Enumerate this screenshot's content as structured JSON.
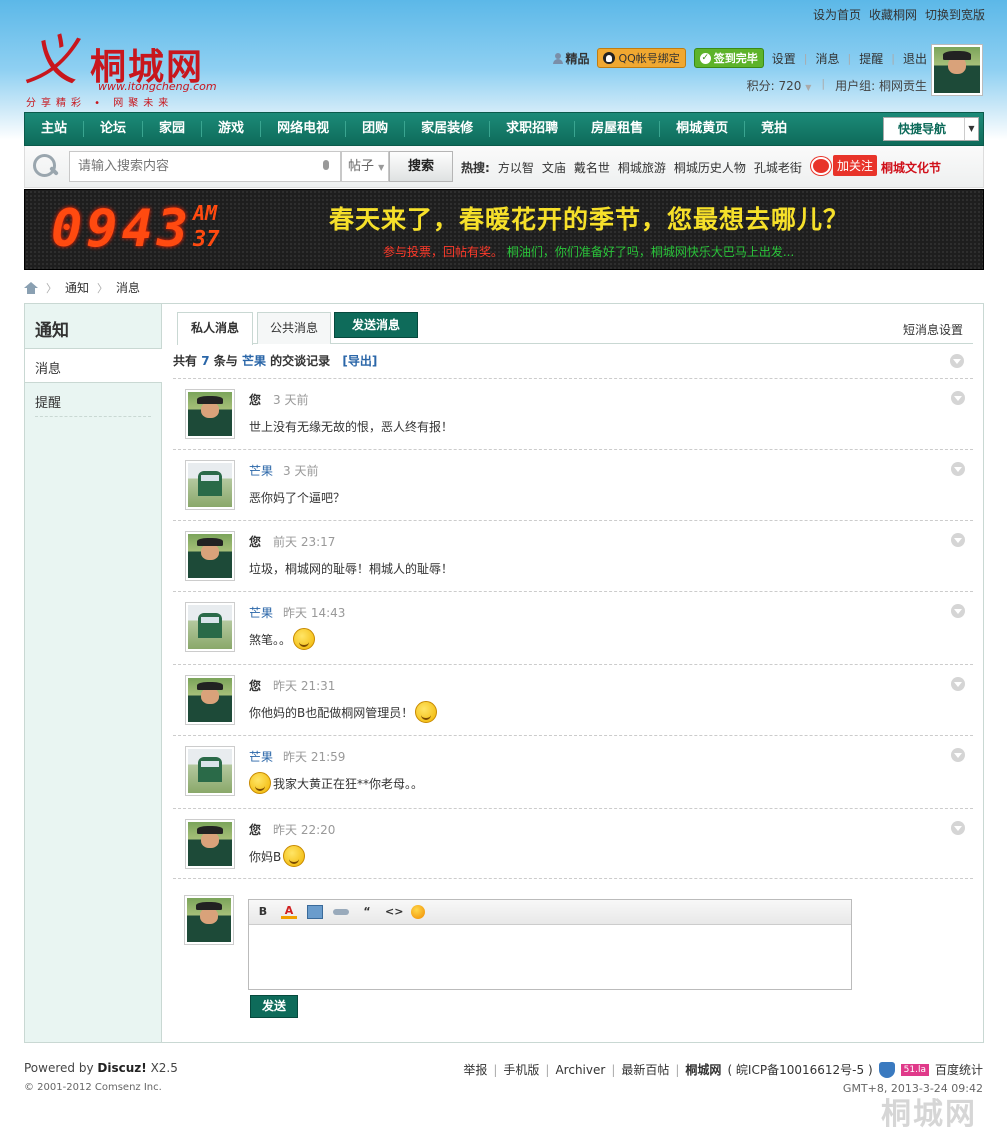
{
  "top_links": [
    "设为首页",
    "收藏桐网",
    "切换到宽版"
  ],
  "logo": {
    "mark": "义",
    "name": "桐城网",
    "url": "www.itongcheng.com",
    "slogan": "分享精彩 • 网聚未来"
  },
  "user": {
    "jingpin": "精品",
    "qq_bind": "QQ帐号绑定",
    "signin": "签到完毕",
    "links": [
      "设置",
      "消息",
      "提醒",
      "退出"
    ],
    "score": "积分: 720",
    "group": "用户组: 桐网贡生"
  },
  "nav": {
    "items": [
      "主站",
      "论坛",
      "家园",
      "游戏",
      "网络电视",
      "团购",
      "家居装修",
      "求职招聘",
      "房屋租售",
      "桐城黄页",
      "竞拍"
    ],
    "quick": "快捷导航"
  },
  "search": {
    "placeholder": "请输入搜索内容",
    "type": "帖子",
    "button": "搜索",
    "hot_label": "热搜:",
    "hot_words": [
      "方以智",
      "文庙",
      "戴名世",
      "桐城旅游",
      "桐城历史人物",
      "孔城老街"
    ],
    "follow": "加关注",
    "culture": "桐城文化节"
  },
  "banner": {
    "clock": "0943",
    "ampm": "AM",
    "seconds": "37",
    "headline": "春天来了，春暖花开的季节，您最想去哪儿？",
    "sub_red": "参与投票，回帖有奖。",
    "sub_green": "桐油们，你们准备好了吗，桐城网快乐大巴马上出发..."
  },
  "breadcrumb": [
    "通知",
    "消息"
  ],
  "sidebar": {
    "title": "通知",
    "items": [
      "消息",
      "提醒"
    ]
  },
  "tabs": {
    "private": "私人消息",
    "public": "公共消息",
    "send": "发送消息",
    "settings": "短消息设置"
  },
  "summary": {
    "prefix": "共有",
    "count": "7",
    "mid": "条与",
    "who": "芒果",
    "suffix": "的交谈记录",
    "export": "[导出]"
  },
  "messages": [
    {
      "from": "您",
      "time": "3 天前",
      "text": "世上没有无缘无故的恨，恶人终有报！"
    },
    {
      "from": "芒果",
      "time": "3 天前",
      "text": "恶你妈了个逼吧？"
    },
    {
      "from": "您",
      "time": "前天 23:17",
      "text": "垃圾，桐城网的耻辱！桐城人的耻辱！"
    },
    {
      "from": "芒果",
      "time": "昨天 14:43",
      "text": "煞笔。。"
    },
    {
      "from": "您",
      "time": "昨天 21:31",
      "text": "你他妈的B也配做桐网管理员！"
    },
    {
      "from": "芒果",
      "time": "昨天 21:59",
      "text": "我家大黄正在狂**你老母。。"
    },
    {
      "from": "您",
      "time": "昨天 22:20",
      "text": "你妈B"
    }
  ],
  "editor": {
    "send": "发送",
    "tools": [
      "bold-icon",
      "font-color-icon",
      "image-icon",
      "link-icon",
      "quote-icon",
      "code-icon",
      "smiley-icon"
    ]
  },
  "footer": {
    "powered_prefix": "Powered by",
    "powered_brand": "Discuz!",
    "powered_version": "X2.5",
    "copyright": "© 2001-2012 Comsenz Inc.",
    "links": [
      "举报",
      "手机版",
      "Archiver",
      "最新百帖"
    ],
    "site": "桐城网",
    "icp": "( 皖ICP备10016612号-5 )",
    "la51": "51.la",
    "stats": "百度统计",
    "gmt": "GMT+8, 2013-3-24 09:42",
    "watermark": "桐城网"
  }
}
